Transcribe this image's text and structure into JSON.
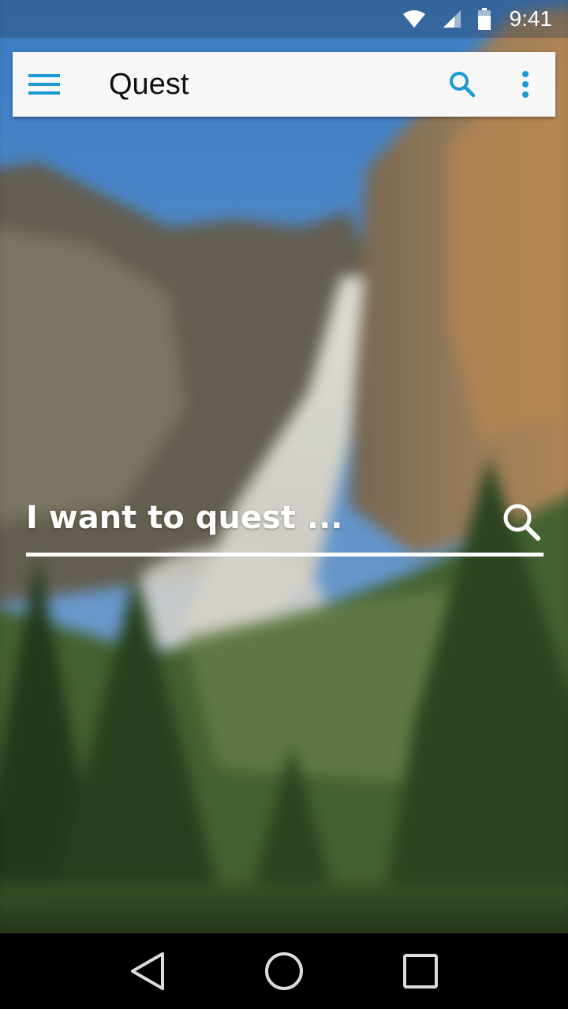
{
  "status_bar": {
    "time": "9:41",
    "icons": [
      "wifi-icon",
      "cell-signal-icon",
      "battery-icon"
    ]
  },
  "app_bar": {
    "title": "Quest",
    "menu_icon": "hamburger-menu-icon",
    "search_icon": "search-icon",
    "more_icon": "more-vert-icon",
    "accent_color": "#1a9ad6"
  },
  "search": {
    "placeholder": "I want to quest ...",
    "icon": "search-icon"
  },
  "nav_bar": {
    "icons": [
      "back-icon",
      "home-icon",
      "recents-icon"
    ]
  },
  "background": {
    "description_colors": [
      "#4f86c7",
      "#8a7a62",
      "#c99b6b",
      "#2f4a22"
    ]
  }
}
